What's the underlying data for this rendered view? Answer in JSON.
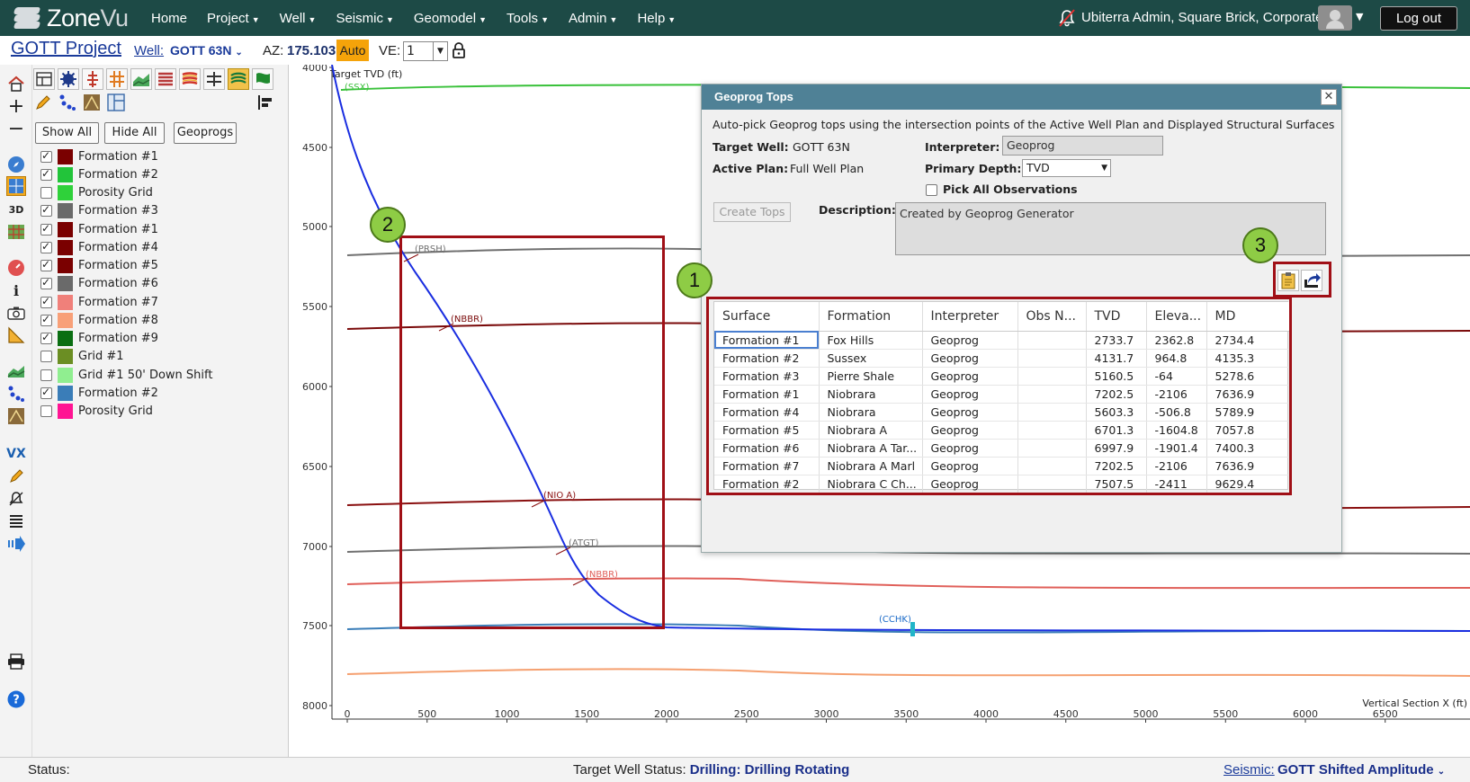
{
  "app": {
    "logo_main": "Zone",
    "logo_accent": "Vu",
    "nav": [
      {
        "label": "Home",
        "dropdown": false
      },
      {
        "label": "Project",
        "dropdown": true
      },
      {
        "label": "Well",
        "dropdown": true
      },
      {
        "label": "Seismic",
        "dropdown": true
      },
      {
        "label": "Geomodel",
        "dropdown": true
      },
      {
        "label": "Tools",
        "dropdown": true
      },
      {
        "label": "Admin",
        "dropdown": true
      },
      {
        "label": "Help",
        "dropdown": true
      }
    ],
    "user": "Ubiterra Admin, Square Brick, Corporate",
    "logout": "Log out"
  },
  "subbar": {
    "project": "GOTT Project",
    "well_label": "Well:",
    "well_name": "GOTT 63N",
    "az_label": "AZ:",
    "az_value": "175.103°",
    "auto": "Auto",
    "ve_label": "VE:",
    "ve_value": "1"
  },
  "panel": {
    "buttons": {
      "show_all": "Show All",
      "hide_all": "Hide All",
      "geoprogs": "Geoprogs"
    },
    "layers": [
      {
        "label": "Formation #1",
        "checked": true,
        "color": "#7a0000"
      },
      {
        "label": "Formation #2",
        "checked": true,
        "color": "#22c43a"
      },
      {
        "label": "Porosity Grid",
        "checked": false,
        "color": "#2fd13a"
      },
      {
        "label": "Formation #3",
        "checked": true,
        "color": "#6a6a6a"
      },
      {
        "label": "Formation #1",
        "checked": true,
        "color": "#7a0000"
      },
      {
        "label": "Formation #4",
        "checked": true,
        "color": "#7a0000"
      },
      {
        "label": "Formation #5",
        "checked": true,
        "color": "#7a0000"
      },
      {
        "label": "Formation #6",
        "checked": true,
        "color": "#6a6a6a"
      },
      {
        "label": "Formation #7",
        "checked": true,
        "color": "#f0807a"
      },
      {
        "label": "Formation #8",
        "checked": true,
        "color": "#f8a078"
      },
      {
        "label": "Formation #9",
        "checked": true,
        "color": "#0a6e12"
      },
      {
        "label": "Grid #1",
        "checked": false,
        "color": "#6b8e23"
      },
      {
        "label": "Grid #1 50' Down Shift",
        "checked": false,
        "color": "#90ee90"
      },
      {
        "label": "Formation #2",
        "checked": true,
        "color": "#3a7db8"
      },
      {
        "label": "Porosity Grid",
        "checked": false,
        "color": "#ff1493"
      }
    ]
  },
  "plot": {
    "y_axis_title": "Target TVD (ft)",
    "x_axis_title": "Vertical Section X (ft)",
    "y_ticks": [
      "4000",
      "4500",
      "5000",
      "5500",
      "6000",
      "6500",
      "7000",
      "7500",
      "8000"
    ],
    "x_ticks": [
      "0",
      "500",
      "1000",
      "1500",
      "2000",
      "2500",
      "3000",
      "3500",
      "4000",
      "4500",
      "5000",
      "5500",
      "6000",
      "6500"
    ],
    "pick_labels": [
      "(SSX)",
      "(PRSH)",
      "(NBBR)",
      "(NIO A)",
      "(ATGT)",
      "(NBBR)",
      "(CCHK)"
    ]
  },
  "dialog": {
    "title": "Geoprog Tops",
    "description_line": "Auto-pick Geoprog tops using the intersection points of the Active Well Plan and Displayed Structural Surfaces",
    "target_well_label": "Target Well:",
    "target_well": "GOTT 63N",
    "active_plan_label": "Active Plan:",
    "active_plan": "Full Well Plan",
    "interpreter_label": "Interpreter:",
    "interpreter": "Geoprog",
    "primary_depth_label": "Primary Depth:",
    "primary_depth": "TVD",
    "pick_all": "Pick All Observations",
    "create_tops": "Create Tops",
    "description_label": "Description:",
    "description": "Created by Geoprog Generator",
    "columns": [
      "Surface",
      "Formation",
      "Interpreter",
      "Obs N...",
      "TVD",
      "Eleva...",
      "MD"
    ],
    "rows": [
      [
        "Formation #1",
        "Fox Hills",
        "Geoprog",
        "",
        "2733.7",
        "2362.8",
        "2734.4"
      ],
      [
        "Formation #2",
        "Sussex",
        "Geoprog",
        "",
        "4131.7",
        "964.8",
        "4135.3"
      ],
      [
        "Formation #3",
        "Pierre Shale",
        "Geoprog",
        "",
        "5160.5",
        "-64",
        "5278.6"
      ],
      [
        "Formation #1",
        "Niobrara",
        "Geoprog",
        "",
        "7202.5",
        "-2106",
        "7636.9"
      ],
      [
        "Formation #4",
        "Niobrara",
        "Geoprog",
        "",
        "5603.3",
        "-506.8",
        "5789.9"
      ],
      [
        "Formation #5",
        "Niobrara A",
        "Geoprog",
        "",
        "6701.3",
        "-1604.8",
        "7057.8"
      ],
      [
        "Formation #6",
        "Niobrara A Tar...",
        "Geoprog",
        "",
        "6997.9",
        "-1901.4",
        "7400.3"
      ],
      [
        "Formation #7",
        "Niobrara A Marl",
        "Geoprog",
        "",
        "7202.5",
        "-2106",
        "7636.9"
      ],
      [
        "Formation #2",
        "Niobrara C Ch...",
        "Geoprog",
        "",
        "7507.5",
        "-2411",
        "9629.4"
      ]
    ]
  },
  "annotations": [
    "1",
    "2",
    "3"
  ],
  "status": {
    "label": "Status:",
    "target_well_status_label": "Target Well Status:",
    "target_well_status": "Drilling: Drilling Rotating",
    "seismic_label": "Seismic:",
    "seismic_value": "GOTT Shifted Amplitude"
  }
}
